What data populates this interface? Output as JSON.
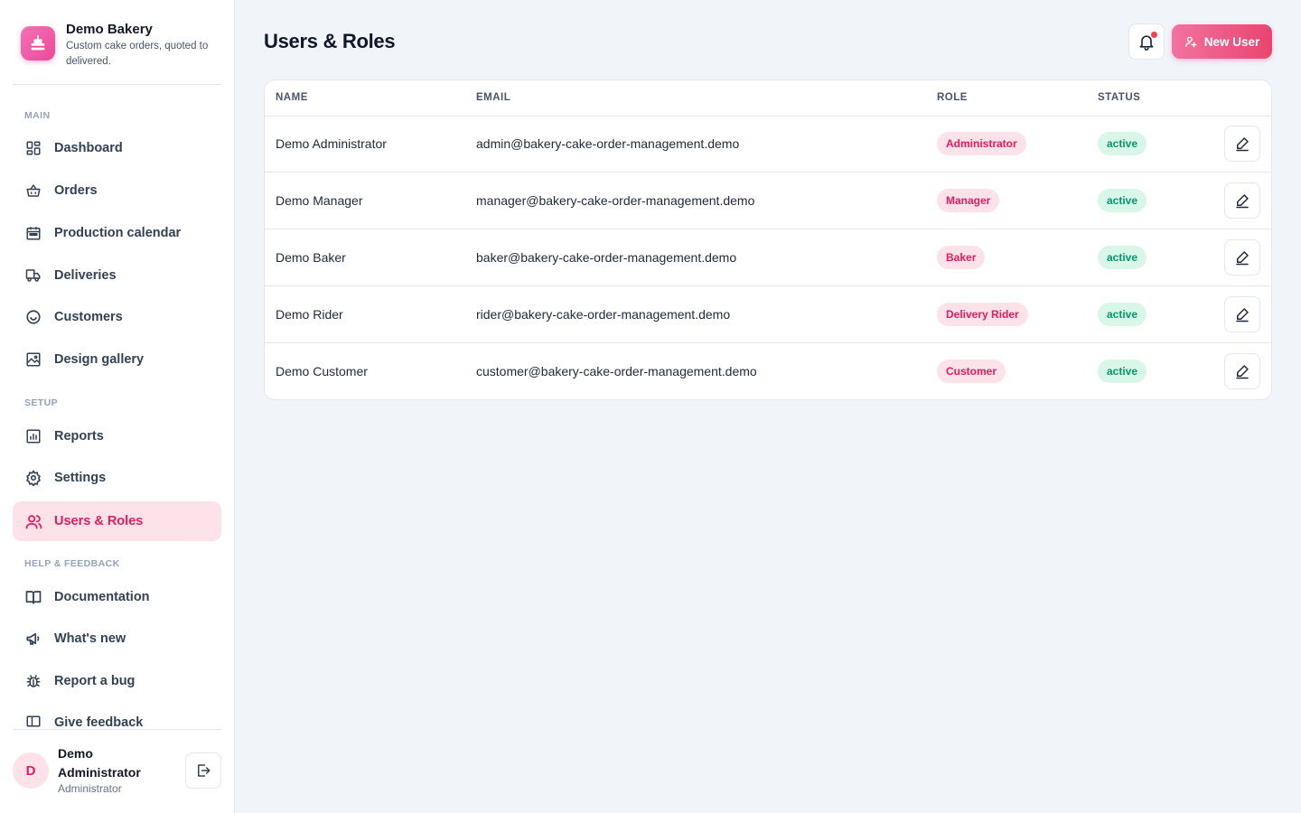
{
  "brand": {
    "name": "Demo Bakery",
    "tagline": "Custom cake orders, quoted to delivered."
  },
  "nav": {
    "sections": [
      {
        "title": "MAIN",
        "items": [
          {
            "label": "Dashboard",
            "icon": "dashboard-icon"
          },
          {
            "label": "Orders",
            "icon": "basket-icon"
          },
          {
            "label": "Production calendar",
            "icon": "calendar-icon"
          },
          {
            "label": "Deliveries",
            "icon": "delivery-icon"
          },
          {
            "label": "Customers",
            "icon": "smile-icon"
          },
          {
            "label": "Design gallery",
            "icon": "gallery-icon"
          }
        ]
      },
      {
        "title": "SETUP",
        "items": [
          {
            "label": "Reports",
            "icon": "report-icon"
          },
          {
            "label": "Settings",
            "icon": "gear-icon"
          },
          {
            "label": "Users & Roles",
            "icon": "users-icon",
            "active": true
          }
        ]
      },
      {
        "title": "HELP & FEEDBACK",
        "items": [
          {
            "label": "Documentation",
            "icon": "book-icon"
          },
          {
            "label": "What's new",
            "icon": "megaphone-icon"
          },
          {
            "label": "Report a bug",
            "icon": "bug-icon"
          },
          {
            "label": "Give feedback",
            "icon": "feedback-icon"
          }
        ]
      }
    ]
  },
  "user": {
    "initial": "D",
    "name": "Demo Administrator",
    "role": "Administrator"
  },
  "header": {
    "title": "Users & Roles",
    "new_user_label": "New User"
  },
  "table": {
    "columns": [
      "NAME",
      "EMAIL",
      "ROLE",
      "STATUS"
    ],
    "rows": [
      {
        "name": "Demo Administrator",
        "email": "admin@bakery-cake-order-management.demo",
        "role": "Administrator",
        "status": "active"
      },
      {
        "name": "Demo Manager",
        "email": "manager@bakery-cake-order-management.demo",
        "role": "Manager",
        "status": "active"
      },
      {
        "name": "Demo Baker",
        "email": "baker@bakery-cake-order-management.demo",
        "role": "Baker",
        "status": "active"
      },
      {
        "name": "Demo Rider",
        "email": "rider@bakery-cake-order-management.demo",
        "role": "Delivery Rider",
        "status": "active"
      },
      {
        "name": "Demo Customer",
        "email": "customer@bakery-cake-order-management.demo",
        "role": "Customer",
        "status": "active"
      }
    ]
  },
  "colors": {
    "accent": "#e11d5c",
    "accent_soft": "#fde2ea",
    "success": "#059669",
    "success_soft": "#d9f7e8"
  }
}
